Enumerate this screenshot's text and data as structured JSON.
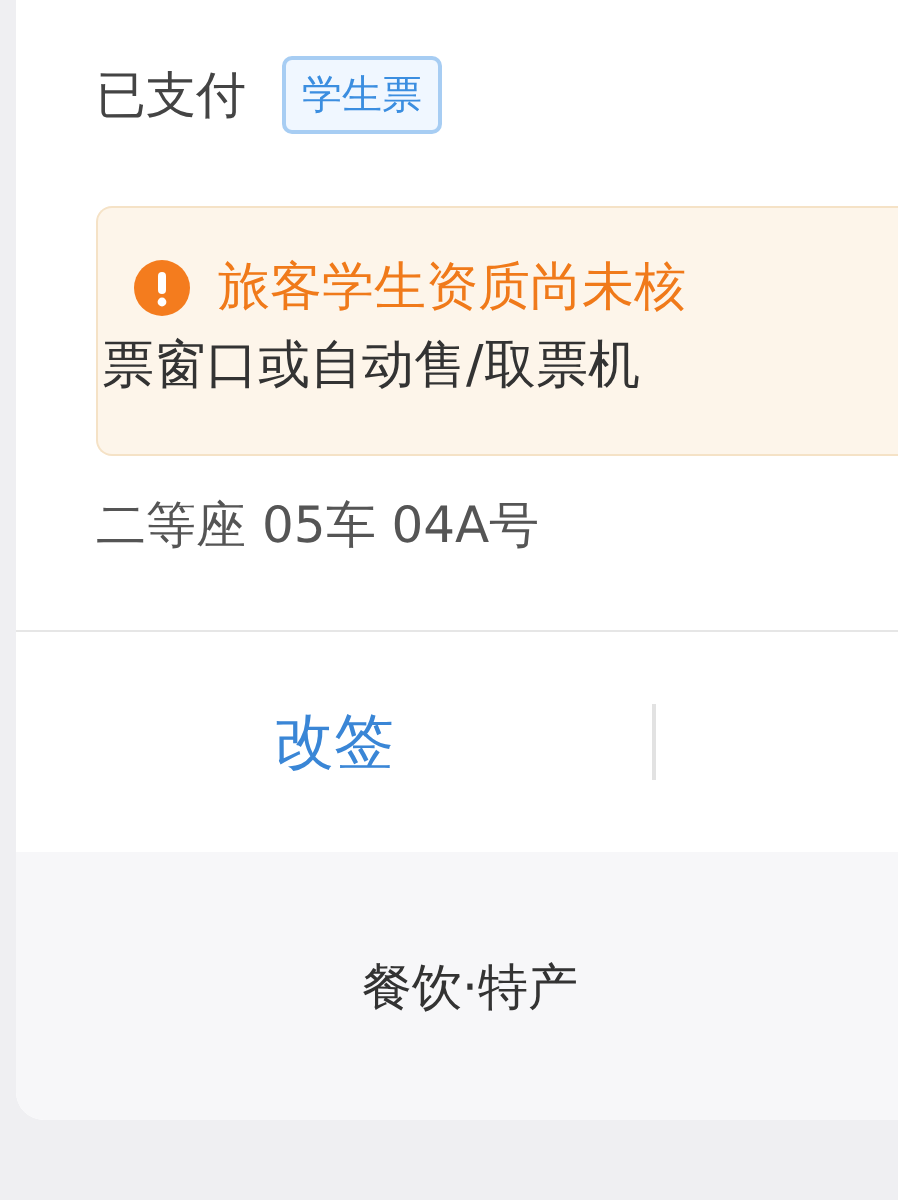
{
  "payment": {
    "status": "已支付",
    "badge": "学生票"
  },
  "notice": {
    "title": "旅客学生资质尚未核",
    "text": "票窗口或自动售/取票机"
  },
  "seat": "二等座 05车 04A号",
  "actions": [
    {
      "label": "改签"
    }
  ],
  "footer_link": "餐饮·特产"
}
